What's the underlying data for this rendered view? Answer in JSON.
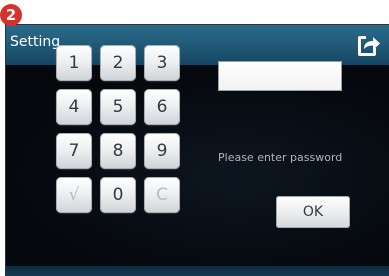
{
  "step_badge": "2",
  "header": {
    "title": "Setting",
    "share_icon": "share-arrow-icon"
  },
  "keypad": {
    "keys": [
      {
        "label": "1",
        "enabled": true
      },
      {
        "label": "2",
        "enabled": true
      },
      {
        "label": "3",
        "enabled": true
      },
      {
        "label": "4",
        "enabled": true
      },
      {
        "label": "5",
        "enabled": true
      },
      {
        "label": "6",
        "enabled": true
      },
      {
        "label": "7",
        "enabled": true
      },
      {
        "label": "8",
        "enabled": true
      },
      {
        "label": "9",
        "enabled": true
      },
      {
        "label": "√",
        "enabled": false
      },
      {
        "label": "0",
        "enabled": true
      },
      {
        "label": "C",
        "enabled": false
      }
    ]
  },
  "password": {
    "value": "",
    "prompt": "Please enter password"
  },
  "ok_label": "OK",
  "colors": {
    "badge": "#d9302a",
    "titlebar": "#1f5876",
    "screen_bg": "#05080d",
    "prompt_text": "#aeb5bb"
  }
}
